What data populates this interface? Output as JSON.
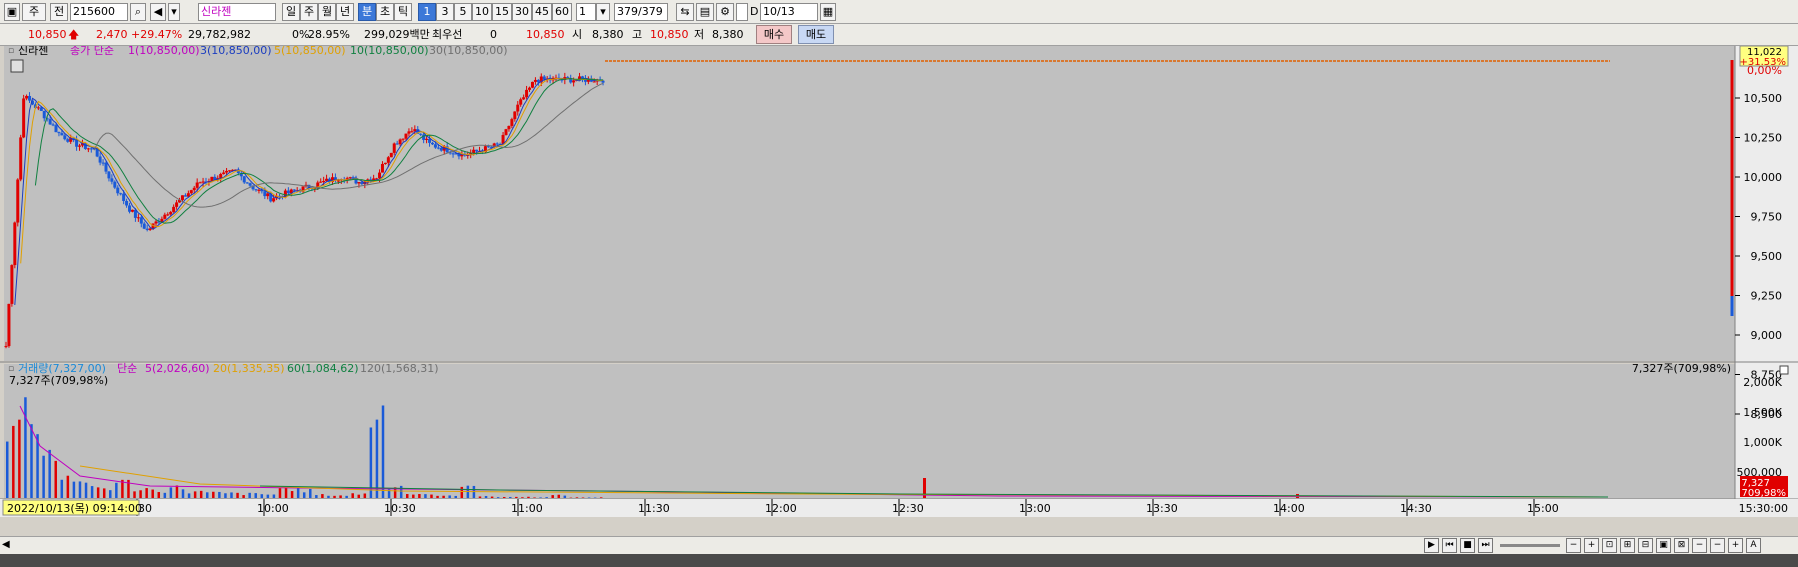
{
  "toolbar": {
    "market": "주",
    "type": "전",
    "code": "215600",
    "stock_name": "신라젠",
    "periods": [
      "일",
      "주",
      "월",
      "년",
      "분",
      "초",
      "틱"
    ],
    "selected_period": "분",
    "intervals": [
      "1",
      "3",
      "5",
      "10",
      "15",
      "30",
      "45",
      "60"
    ],
    "selected_interval": "1",
    "count_value": "1",
    "count_current": "379",
    "count_total": "/379",
    "date": "10/13"
  },
  "info": {
    "price": "10,850",
    "change": "2,470",
    "change_pct": "+29.47%",
    "volume": "29,782,982",
    "ratio": "0%",
    "ratio_pct": "28.95%",
    "amount": "299,029백만",
    "pref_label": "최우선",
    "pref_value": "0",
    "bid": "10,850",
    "open_label": "시",
    "open": "8,380",
    "high_label": "고",
    "high": "10,850",
    "low_label": "저",
    "low": "8,380",
    "buy_label": "매수",
    "sell_label": "매도"
  },
  "price_panel": {
    "name": "신라젠",
    "ma_label": "종가 단순",
    "ma": [
      {
        "label": "1(10,850,00)",
        "color": "#c000c0"
      },
      {
        "label": "3(10,850,00)",
        "color": "#1a3cc0"
      },
      {
        "label": "5(10,850,00)",
        "color": "#e0a000"
      },
      {
        "label": "10(10,850,00)",
        "color": "#108040"
      },
      {
        "label": "30(10,850,00)",
        "color": "#707070"
      }
    ],
    "y_ticks": [
      "10,500",
      "10,250",
      "10,000",
      "9,750",
      "9,500",
      "9,250",
      "9,000",
      "8,750",
      "8,500"
    ],
    "top_tick": "0,00%",
    "current_price_box": "11,022",
    "current_pct_box": "+31.53%"
  },
  "volume_panel": {
    "title": "거래량(7,327,00)",
    "ma_label": "단순",
    "ma": [
      {
        "label": "5(2,026,60)",
        "color": "#c000c0"
      },
      {
        "label": "20(1,335,35)",
        "color": "#e0a000"
      },
      {
        "label": "60(1,084,62)",
        "color": "#108040"
      },
      {
        "label": "120(1,568,31)",
        "color": "#707070"
      }
    ],
    "left_note": "7,327주(709,98%)",
    "right_note": "7,327주(709,98%)",
    "y_ticks": [
      "2,000K",
      "1,500K",
      "1,000K",
      "500,000"
    ],
    "current_box": "7,327",
    "current_pct_box": "709,98%"
  },
  "time_axis": {
    "cursor_label": "2022/10/13(목) 09:14:00",
    "ticks": [
      "30",
      "10:00",
      "10:30",
      "11:00",
      "11:30",
      "12:00",
      "12:30",
      "13:00",
      "13:30",
      "14:00",
      "14:30",
      "15:00"
    ],
    "end_label": "15:30:00"
  },
  "colors": {
    "chart_bg": "#c0c0c0",
    "up": "#e00000",
    "down": "#1a5ad8",
    "ma1": "#c000c0",
    "ma3": "#1a3cc0",
    "ma5": "#e0a000",
    "ma10": "#108040",
    "ma30": "#707070"
  },
  "chart_data": {
    "type": "candlestick-volume",
    "price_range": [
      8380,
      11022
    ],
    "price_close_approx": [
      8380,
      10700,
      10550,
      10350,
      10250,
      10200,
      9900,
      9650,
      9450,
      9600,
      9750,
      9900,
      9950,
      10000,
      9850,
      9750,
      9800,
      9850,
      9900,
      9950,
      9900,
      9950,
      10250,
      10400,
      10250,
      10200,
      10150,
      10200,
      10250,
      10600,
      10850,
      10850,
      10850,
      10850,
      10850
    ],
    "volume_range": [
      0,
      2000000
    ],
    "volume_approx": [
      1500000,
      1700000,
      900000,
      400000,
      250000,
      200000,
      300000,
      180000,
      150000,
      200000,
      120000,
      100000,
      90000,
      80000,
      70000,
      200000,
      150000,
      60000,
      50000,
      80000,
      1700000,
      250000,
      80000,
      60000,
      40000,
      300000,
      30000,
      20000,
      20000,
      15000,
      50000,
      10000,
      10000
    ]
  }
}
